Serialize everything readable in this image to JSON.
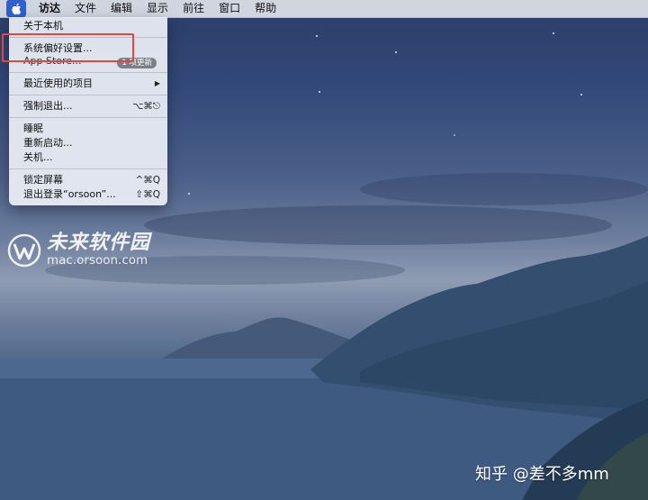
{
  "menubar": {
    "items": [
      "访达",
      "文件",
      "编辑",
      "显示",
      "前往",
      "窗口",
      "帮助"
    ]
  },
  "apple_menu": {
    "about": "关于本机",
    "system_prefs": "系统偏好设置...",
    "app_store": "App Store...",
    "app_store_badge": "1 项更新",
    "recent_items": "最近使用的项目",
    "recent_arrow": "▶",
    "force_quit": "强制退出...",
    "force_quit_shortcut": "⌥⌘⎋",
    "sleep": "睡眠",
    "restart": "重新启动...",
    "shutdown": "关机...",
    "lock_screen": "锁定屏幕",
    "lock_shortcut": "^⌘Q",
    "logout": "退出登录“orsoon”...",
    "logout_shortcut": "⇧⌘Q"
  },
  "watermark": {
    "brand": "未来软件园",
    "url": "mac.orsoon.com",
    "zhihu": "知乎 @差不多mm"
  },
  "colors": {
    "highlight": "#e2473d",
    "apple_selected": "#2f5fd0"
  }
}
